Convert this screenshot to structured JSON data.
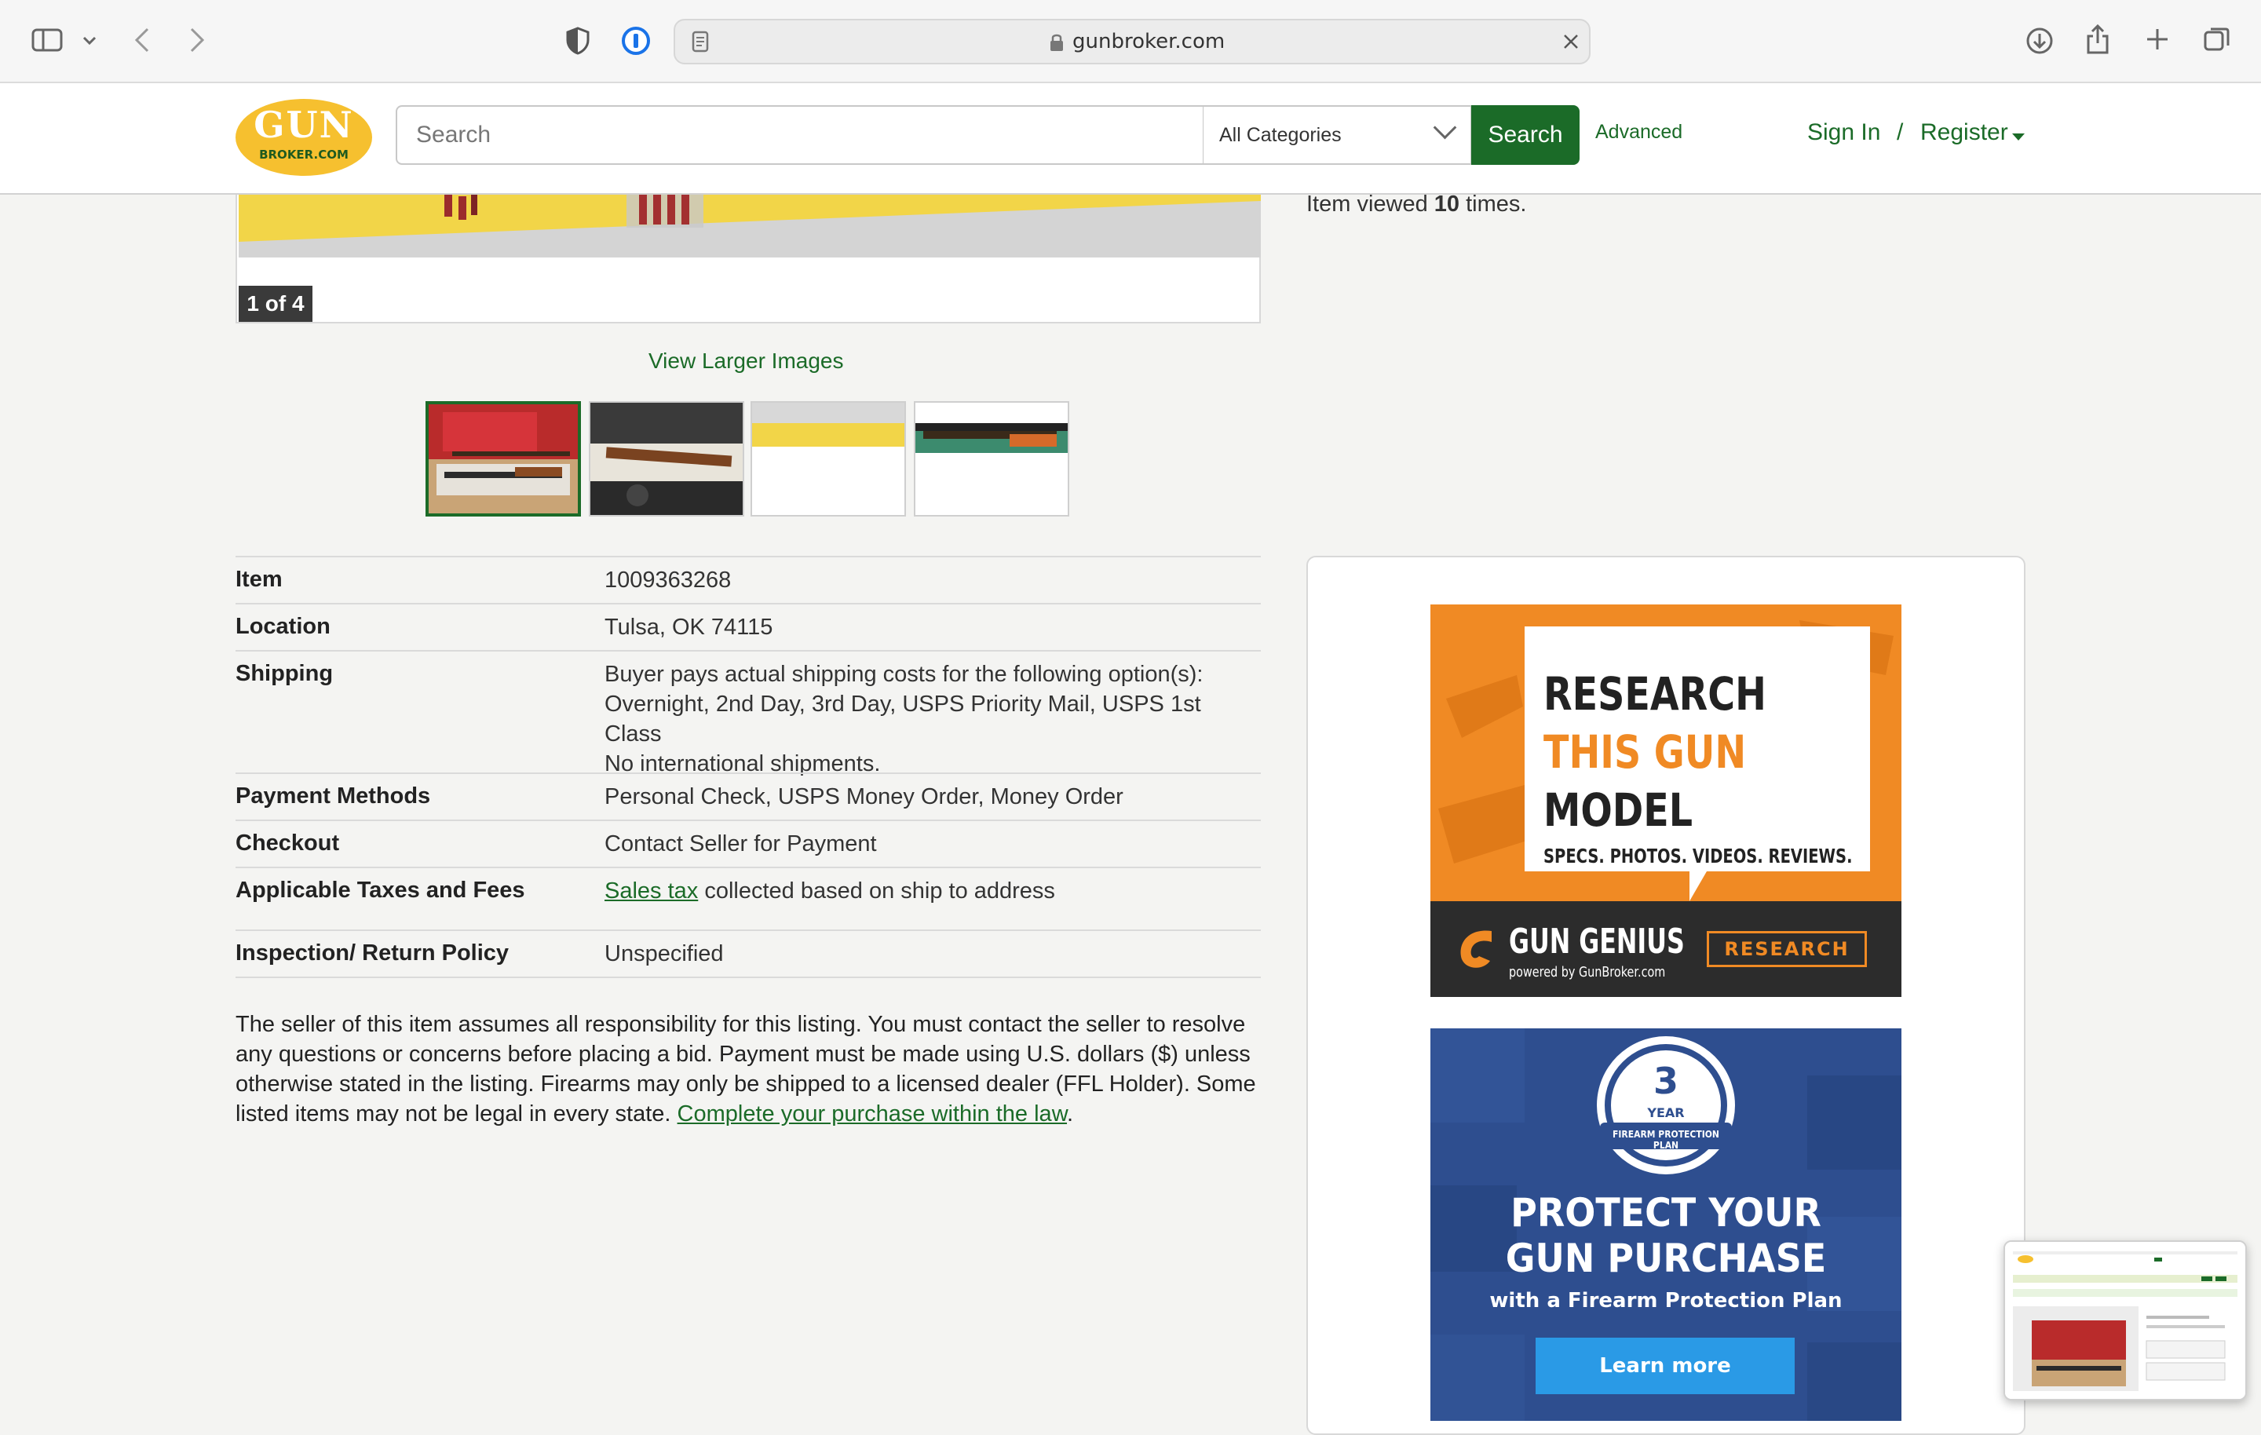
{
  "browser": {
    "url": "gunbroker.com"
  },
  "header": {
    "logo_text_top": "GUN",
    "logo_text_bottom": "BROKER.COM",
    "search_placeholder": "Search",
    "category_selected": "All Categories",
    "search_button": "Search",
    "advanced_link": "Advanced",
    "sign_in": "Sign In",
    "separator": "/",
    "register": "Register"
  },
  "gallery": {
    "counter": "1 of 4",
    "view_larger": "View Larger Images",
    "thumbnail_count": 4,
    "selected_index": 0
  },
  "stats": {
    "viewed_prefix": "Item viewed",
    "viewed_count": "10",
    "viewed_suffix": "times."
  },
  "details": {
    "item_label": "Item",
    "item_value": "1009363268",
    "location_label": "Location",
    "location_value": "Tulsa, OK 74115",
    "shipping_label": "Shipping",
    "shipping_line1": "Buyer pays actual shipping costs for the following option(s):",
    "shipping_line2": "Overnight, 2nd Day, 3rd Day, USPS Priority Mail, USPS 1st Class",
    "shipping_line3": "No international shipments.",
    "payment_label": "Payment Methods",
    "payment_value": "Personal Check, USPS Money Order, Money Order",
    "checkout_label": "Checkout",
    "checkout_value": "Contact Seller for Payment",
    "taxes_label": "Applicable Taxes and Fees",
    "taxes_link": "Sales tax",
    "taxes_rest": " collected based on ship to address",
    "inspection_label": "Inspection/ Return Policy",
    "inspection_value": "Unspecified"
  },
  "disclaimer": {
    "text": "The seller of this item assumes all responsibility for this listing. You must contact the seller to resolve any questions or concerns before placing a bid. Payment must be made using U.S. dollars ($) unless otherwise stated in the listing. Firearms may only be shipped to a licensed dealer (FFL Holder). Some listed items may not be legal in every state. ",
    "link": "Complete your purchase within the law",
    "end": "."
  },
  "ads": {
    "ad1_line1": "RESEARCH",
    "ad1_line2": "THIS GUN",
    "ad1_line3": "MODEL",
    "ad1_tagline": "SPECS. PHOTOS. VIDEOS. REVIEWS.",
    "ad1_brand": "GUN GENIUS",
    "ad1_brand_sub": "powered by GunBroker.com",
    "ad1_button": "RESEARCH",
    "ad2_badge_num": "3",
    "ad2_badge_year": "YEAR",
    "ad2_badge_text": "FIREARM PROTECTION PLAN",
    "ad2_line1": "PROTECT YOUR",
    "ad2_line2": "GUN PURCHASE",
    "ad2_sub": "with a Firearm Protection Plan",
    "ad2_button": "Learn more"
  },
  "colors": {
    "brand_green": "#1b6b28",
    "logo_yellow": "#f6c02f",
    "ad_orange": "#f08a24",
    "ad_blue": "#2e4e8f"
  },
  "icons": [
    "sidebar-icon",
    "chevron-down-icon",
    "back-arrow-icon",
    "forward-arrow-icon",
    "shield-icon",
    "password-manager-icon",
    "reader-icon",
    "lock-icon",
    "close-icon",
    "download-icon",
    "share-icon",
    "new-tab-icon",
    "tabs-overview-icon"
  ]
}
